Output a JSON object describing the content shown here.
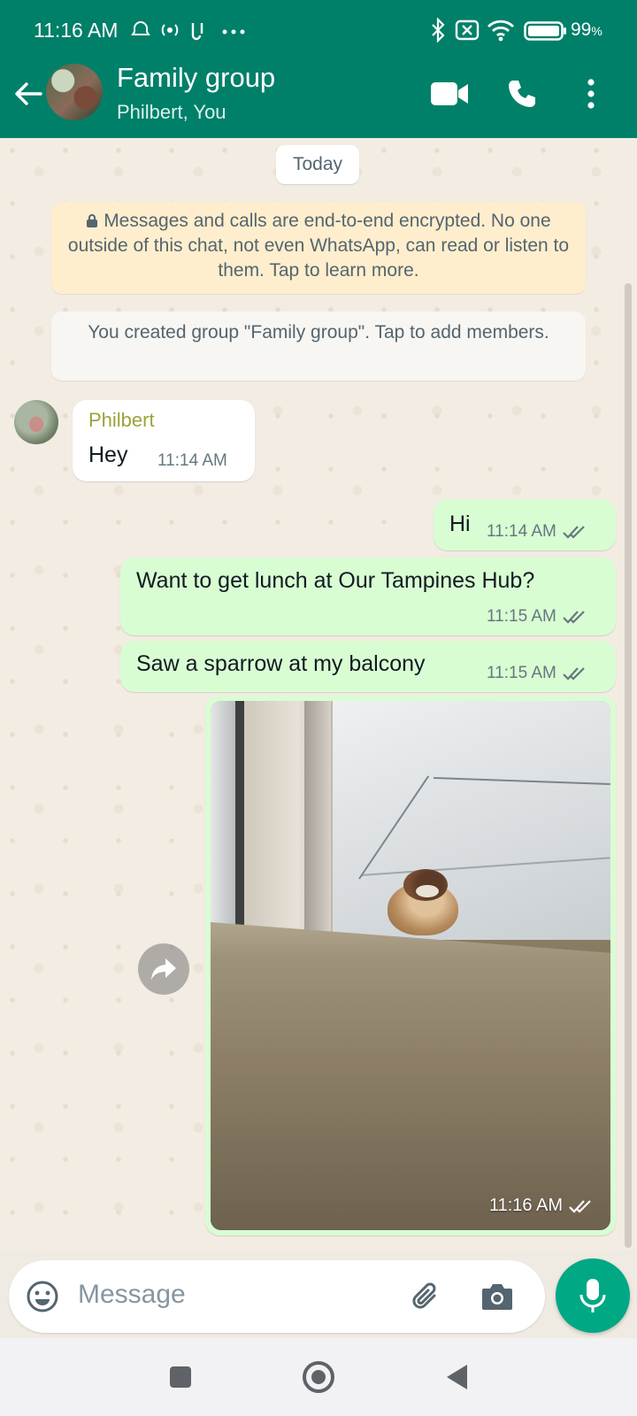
{
  "status_bar": {
    "time": "11:16 AM",
    "battery": "99",
    "battery_unit": "%",
    "icons": [
      "notification-icon",
      "hotspot-icon",
      "nfc-icon",
      "more-dots-icon",
      "bluetooth-icon",
      "sim-off-icon",
      "wifi-icon",
      "battery-icon"
    ]
  },
  "header": {
    "title": "Family group",
    "subtitle": "Philbert, You",
    "icons": [
      "back-arrow-icon",
      "video-call-icon",
      "voice-call-icon",
      "menu-dots-icon"
    ],
    "color": "#008069"
  },
  "chat": {
    "date_chip": "Today",
    "encryption_notice": "Messages and calls are end-to-end encrypted. No one outside of this chat, not even WhatsApp, can read or listen to them. Tap to learn more.",
    "system_message": "You created group \"Family group\". Tap to add members.",
    "messages": [
      {
        "direction": "in",
        "sender": "Philbert",
        "text": "Hey",
        "time": "11:14 AM"
      },
      {
        "direction": "out",
        "text": "Hi",
        "time": "11:14 AM",
        "status": "read"
      },
      {
        "direction": "out",
        "text": "Want to get lunch at Our Tampines Hub?",
        "time": "11:15 AM",
        "status": "read"
      },
      {
        "direction": "out",
        "text": "Saw a sparrow at my balcony",
        "time": "11:15 AM",
        "status": "read"
      },
      {
        "direction": "out",
        "type": "image",
        "time": "11:16 AM",
        "status": "read"
      }
    ],
    "incoming_bubble_color": "#ffffff",
    "outgoing_bubble_color": "#d9fdd3",
    "sender_name_color": "#9ba33b"
  },
  "input": {
    "placeholder": "Message",
    "icons": [
      "emoji-icon",
      "attach-icon",
      "camera-icon",
      "mic-icon"
    ],
    "accent": "#00a884"
  },
  "navigation": {
    "icons": [
      "recents-square-icon",
      "home-circle-icon",
      "back-triangle-icon"
    ]
  }
}
